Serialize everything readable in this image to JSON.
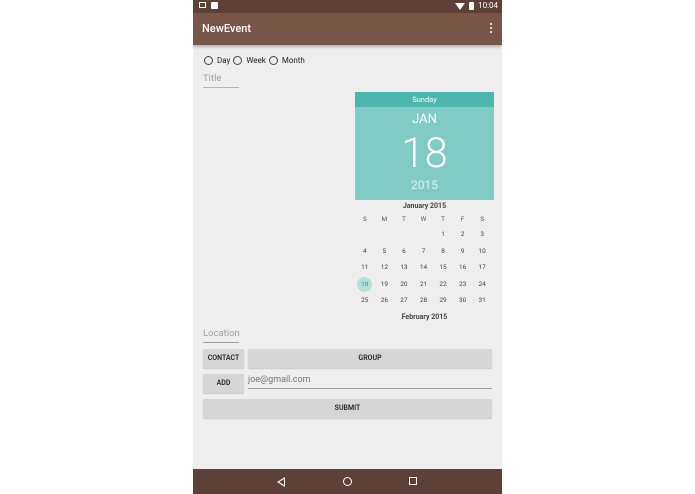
{
  "status_bar": {
    "time": "10:04"
  },
  "app_bar": {
    "title": "NewEvent"
  },
  "radios": [
    {
      "label": "Day",
      "checked": false
    },
    {
      "label": "Week",
      "checked": false
    },
    {
      "label": "Month",
      "checked": false
    }
  ],
  "title_field": {
    "placeholder": "Title"
  },
  "location_field": {
    "placeholder": "Location"
  },
  "calendar": {
    "day_of_week": "Sunday",
    "month": "JAN",
    "day": "18",
    "year": "2015",
    "grid_month_label": "January 2015",
    "next_month_label": "February 2015",
    "weekday_headers": [
      "S",
      "M",
      "T",
      "W",
      "T",
      "F",
      "S"
    ],
    "weeks": [
      [
        "",
        "",
        "",
        "",
        "1",
        "2",
        "3"
      ],
      [
        "4",
        "5",
        "6",
        "7",
        "8",
        "9",
        "10"
      ],
      [
        "11",
        "12",
        "13",
        "14",
        "15",
        "16",
        "17"
      ],
      [
        "18",
        "19",
        "20",
        "21",
        "22",
        "23",
        "24"
      ],
      [
        "25",
        "26",
        "27",
        "28",
        "29",
        "30",
        "31"
      ]
    ],
    "selected_day": "18"
  },
  "buttons": {
    "contact": "CONTACT",
    "group": "GROUP",
    "add": "ADD",
    "submit": "SUBMIT"
  },
  "email_field": {
    "value": "joe@gmail.com"
  },
  "colors": {
    "status_bar": "#5d4037",
    "app_bar": "#795548",
    "calendar_header": "#80cbc4",
    "calendar_dow": "#4db6ac",
    "background": "#eeeeee"
  }
}
